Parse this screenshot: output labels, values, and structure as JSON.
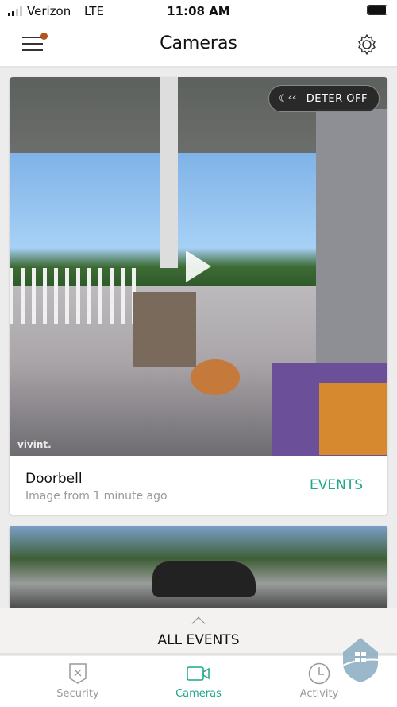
{
  "status_bar": {
    "carrier": "Verizon",
    "network": "LTE",
    "time": "11:08 AM",
    "battery_level": 1.0
  },
  "header": {
    "title": "Cameras",
    "menu_notification": true
  },
  "cameras": [
    {
      "overlay_button": "DETER OFF",
      "watermark": "vivint.",
      "name": "Doorbell",
      "subtitle": "Image from 1 minute ago",
      "events_label": "EVENTS"
    },
    {}
  ],
  "all_events": {
    "label": "ALL EVENTS"
  },
  "tabs": [
    {
      "label": "Security",
      "icon": "shield-x-icon"
    },
    {
      "label": "Cameras",
      "icon": "video-camera-icon",
      "active": true
    },
    {
      "label": "Activity",
      "icon": "clock-icon"
    }
  ],
  "colors": {
    "accent": "#1aa88a",
    "notification": "#b5541c"
  }
}
